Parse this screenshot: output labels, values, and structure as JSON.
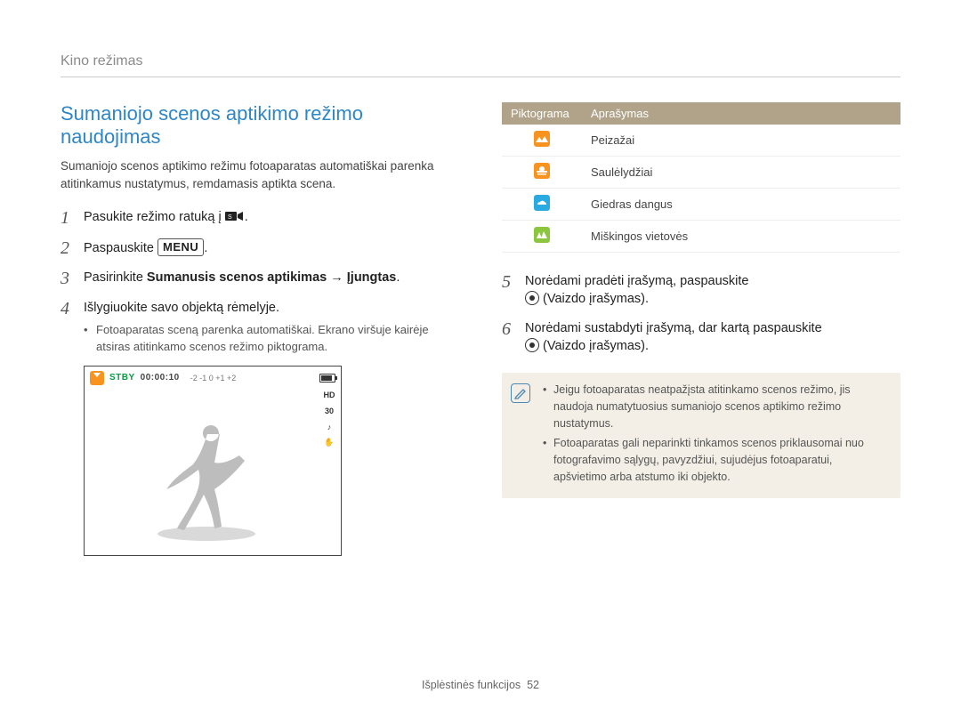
{
  "header": {
    "section": "Kino režimas"
  },
  "left": {
    "title": "Sumaniojo scenos aptikimo režimo naudojimas",
    "intro": "Sumaniojo scenos aptikimo režimu fotoaparatas automatiškai parenka atitinkamus nustatymus, remdamasis aptikta scena.",
    "steps": {
      "s1a": "Pasukite režimo ratuką į ",
      "s1b": ".",
      "s2a": "Paspauskite ",
      "s2b": ".",
      "menu_label": "MENU",
      "s3a": "Pasirinkite ",
      "s3b": "Sumanusis scenos aptikimas",
      "s3c": " → ",
      "s3d": "Įjungtas",
      "s3e": ".",
      "s4": "Išlygiuokite savo objektą rėmelyje.",
      "s4_sub": "Fotoaparatas sceną parenka automatiškai. Ekrano viršuje kairėje atsiras atitinkamo scenos režimo piktograma."
    },
    "lcd": {
      "stby": "STBY",
      "tc": "00:00:10",
      "ev": "-2   -1    0   +1   +2",
      "hd": "HD",
      "v30": "30",
      "mic": "♪",
      "is": "✋"
    }
  },
  "right": {
    "table": {
      "head_icon": "Piktograma",
      "head_desc": "Aprašymas",
      "rows": [
        {
          "color": "#f7931e",
          "svg": "landscape",
          "desc": "Peizažai"
        },
        {
          "color": "#f7931e",
          "svg": "sunset",
          "desc": "Saulėlydžiai"
        },
        {
          "color": "#29abe2",
          "svg": "sky",
          "desc": "Giedras dangus"
        },
        {
          "color": "#8cc63f",
          "svg": "forest",
          "desc": "Miškingos vietovės"
        }
      ]
    },
    "step5a": "Norėdami pradėti įrašymą, paspauskite ",
    "step5b": " (Vaizdo įrašymas).",
    "step6a": "Norėdami sustabdyti įrašymą, dar kartą paspauskite ",
    "step6b": " (Vaizdo įrašymas).",
    "note1": "Jeigu fotoaparatas neatpažįsta atitinkamo scenos režimo, jis naudoja numatytuosius sumaniojo scenos aptikimo režimo nustatymus.",
    "note2": "Fotoaparatas gali neparinkti tinkamos scenos priklausomai nuo fotografavimo sąlygų, pavyzdžiui, sujudėjus fotoaparatui, apšvietimo arba atstumo iki objekto."
  },
  "footer": {
    "label": "Išplėstinės funkcijos",
    "page": "52"
  }
}
